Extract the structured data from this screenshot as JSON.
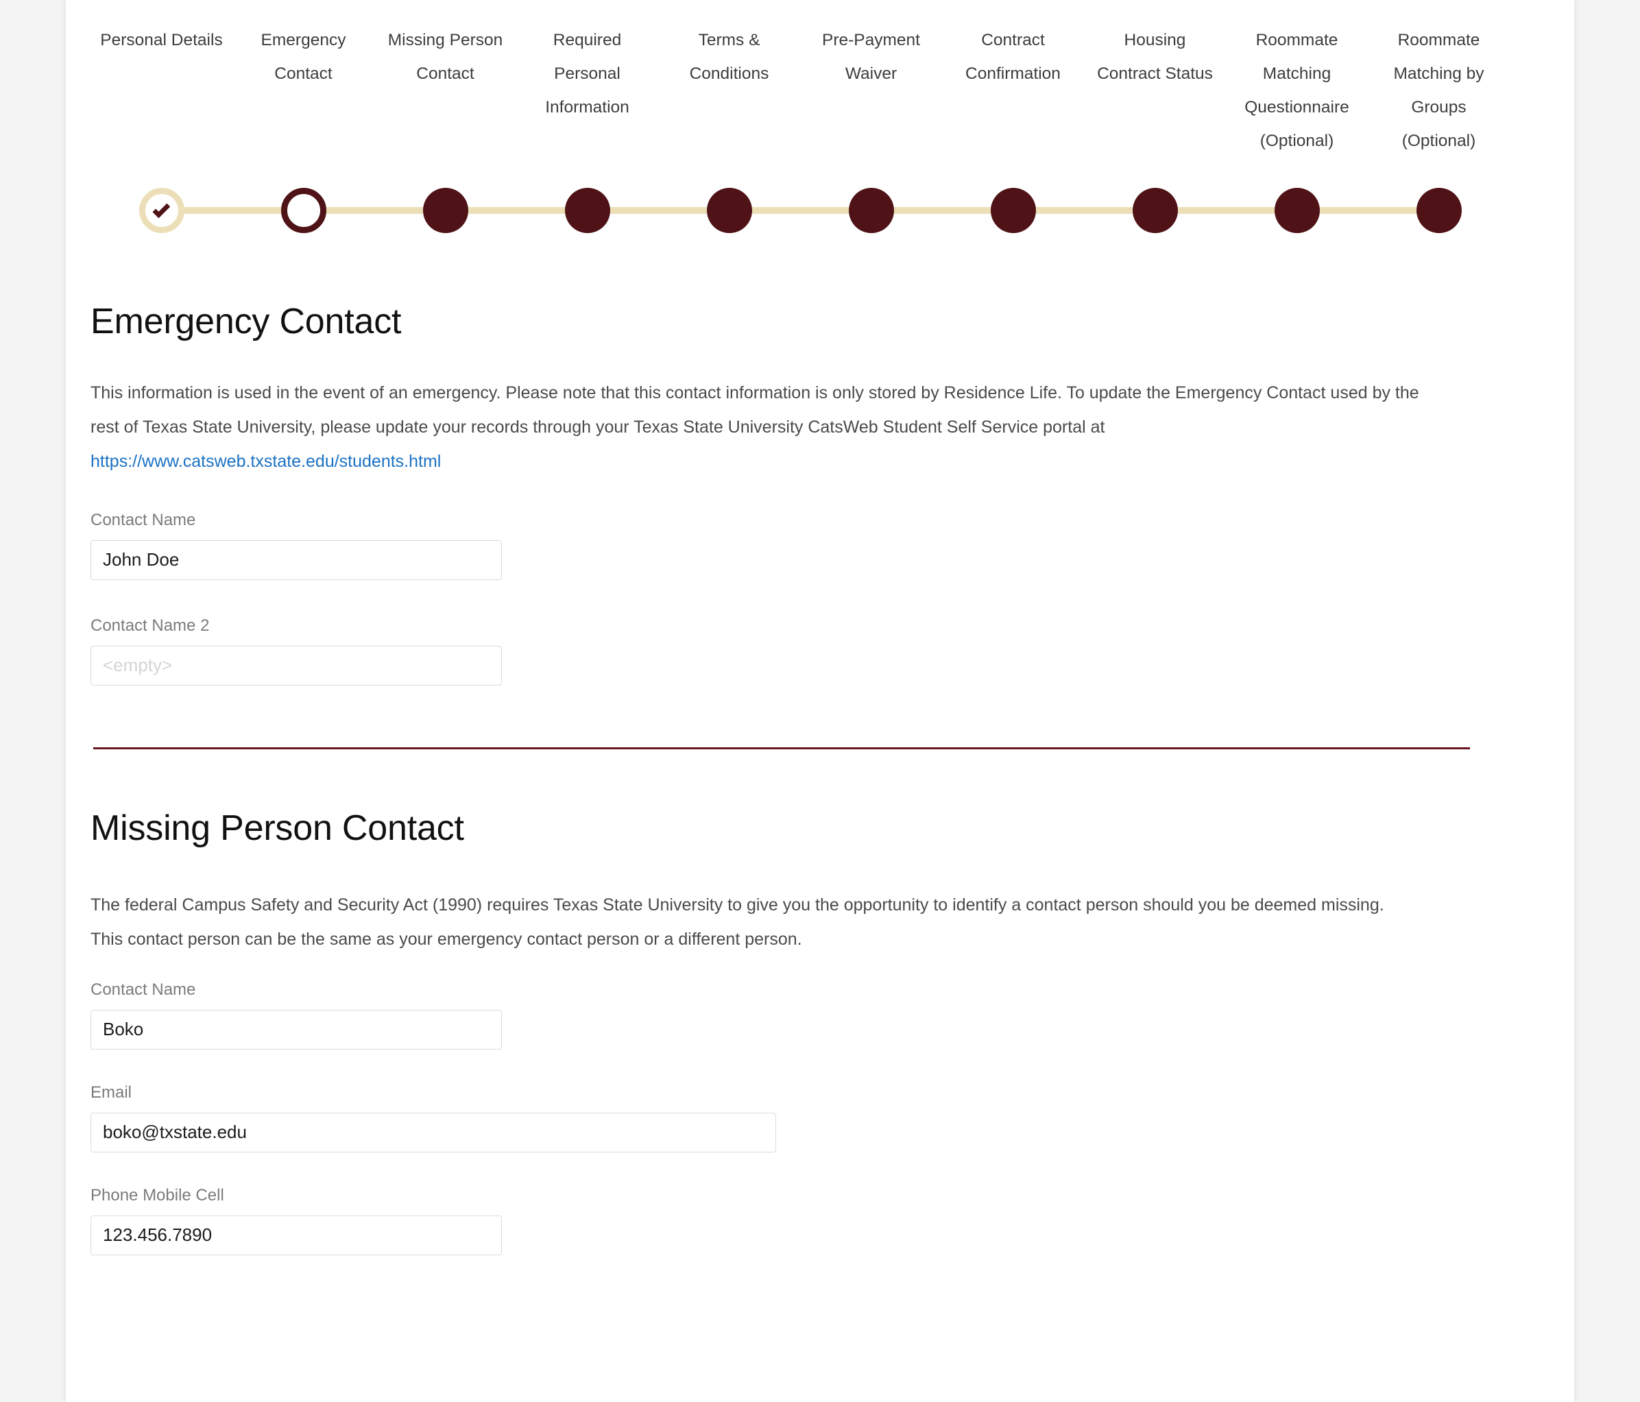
{
  "stepper": {
    "steps": [
      {
        "label": "Personal Details",
        "state": "done"
      },
      {
        "label": "Emergency Contact",
        "state": "current"
      },
      {
        "label": "Missing Person Contact",
        "state": "todo"
      },
      {
        "label": "Required Personal Information",
        "state": "todo"
      },
      {
        "label": "Terms & Conditions",
        "state": "todo"
      },
      {
        "label": "Pre-Payment Waiver",
        "state": "todo"
      },
      {
        "label": "Contract Confirmation",
        "state": "todo"
      },
      {
        "label": "Housing Contract Status",
        "state": "todo"
      },
      {
        "label": "Roommate Matching Questionnaire (Optional)",
        "state": "todo"
      },
      {
        "label": "Roommate Matching by Groups (Optional)",
        "state": "todo"
      }
    ],
    "colors": {
      "completed": "#ecdfb8",
      "active": "#4f1317",
      "upcoming": "#4f1317",
      "connector": "#ecdfb8"
    }
  },
  "emergency_contact": {
    "title": "Emergency Contact",
    "description_part1": "This information is used in the event of an emergency. Please note that this contact information is only stored by Residence Life. To update the Emergency Contact used by the rest of Texas State University, please update your records through your Texas State University CatsWeb Student Self Service portal at ",
    "link_text": "https://www.catsweb.txstate.edu/students.html",
    "link_color": "#1b72c4",
    "fields": [
      {
        "label": "Contact Name",
        "value": "John Doe",
        "placeholder": ""
      },
      {
        "label": "Contact Name 2",
        "value": "",
        "placeholder": "<empty>"
      }
    ]
  },
  "divider_color": "#6b1420",
  "missing_person_contact": {
    "title": "Missing Person Contact",
    "description": "The federal Campus Safety and Security Act (1990) requires Texas State University to give you the opportunity to identify a contact person should you be deemed missing. This contact person can be the same as your emergency contact person or a different person.",
    "fields": [
      {
        "label": "Contact Name",
        "value": "Boko",
        "placeholder": ""
      },
      {
        "label": "Email",
        "value": "boko@txstate.edu",
        "placeholder": ""
      },
      {
        "label": "Phone Mobile Cell",
        "value": "123.456.7890",
        "placeholder": ""
      }
    ]
  }
}
